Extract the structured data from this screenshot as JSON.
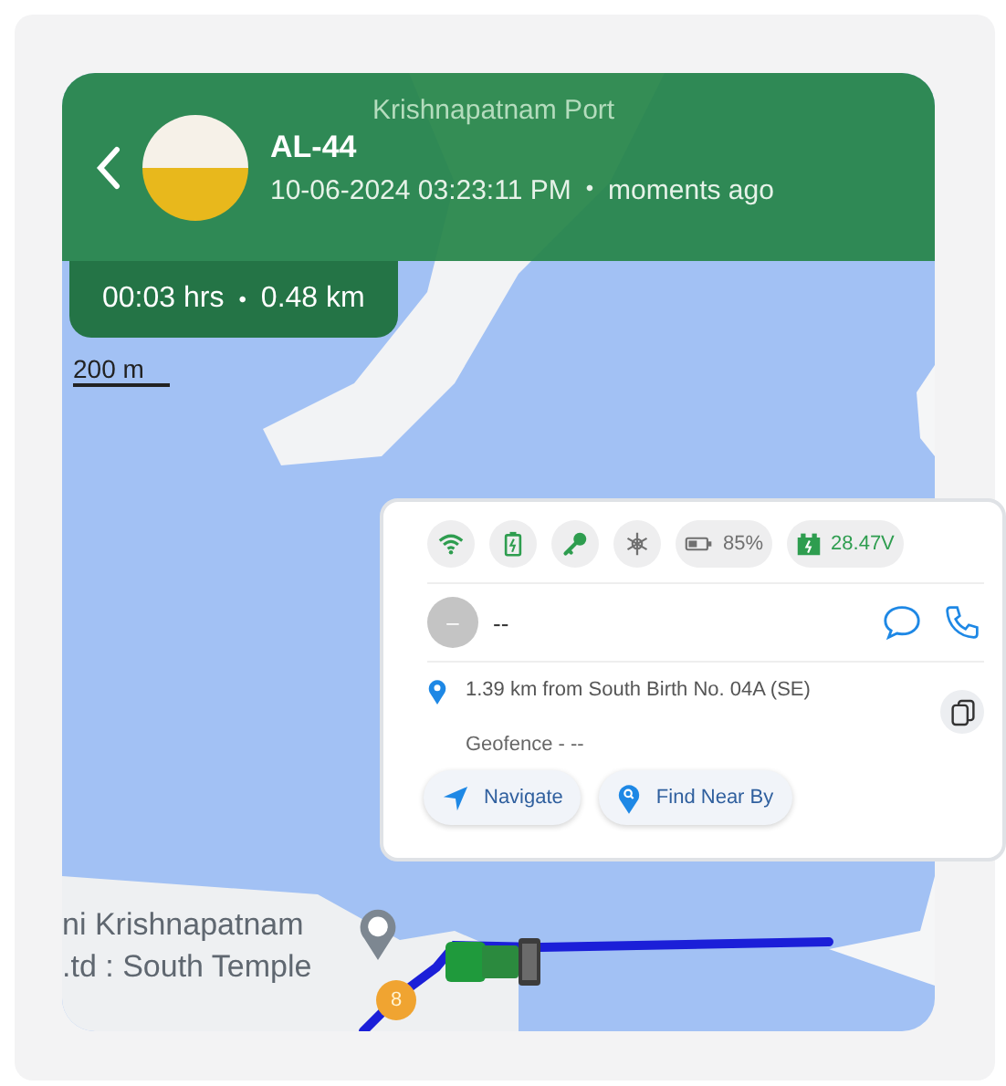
{
  "header": {
    "title": "AL-44",
    "timestamp": "10-06-2024 03:23:11 PM",
    "separator": "•",
    "ago": "moments ago"
  },
  "trip": {
    "duration": "00:03 hrs",
    "separator": "•",
    "distance": "0.48 km"
  },
  "scale": "200 m",
  "map_labels": [
    {
      "kind": "port",
      "text": "Krishnapatnam Port"
    },
    {
      "kind": "place",
      "text": "ni Krishnapatnam"
    },
    {
      "kind": "place",
      "text": ".td : South Temple"
    }
  ],
  "marker_badge": "8",
  "status_chips": [
    {
      "kind": "wifi",
      "color": "#2e9d4f"
    },
    {
      "kind": "battery",
      "color": "#2e9d4f"
    },
    {
      "kind": "ignition",
      "color": "#2e9d4f"
    },
    {
      "kind": "ac",
      "color": "#707070"
    },
    {
      "kind": "battery_level",
      "text": "85%",
      "color": "#707070"
    },
    {
      "kind": "voltage",
      "text": "28.47V",
      "color": "#2e9d4f"
    }
  ],
  "driver": {
    "avatar": "–",
    "name": "--"
  },
  "location": "1.39 km from South Birth No. 04A (SE)",
  "geofence": "Geofence - --",
  "actions": [
    {
      "kind": "navigate",
      "label": "Navigate"
    },
    {
      "kind": "find",
      "label": "Find Near By"
    }
  ]
}
